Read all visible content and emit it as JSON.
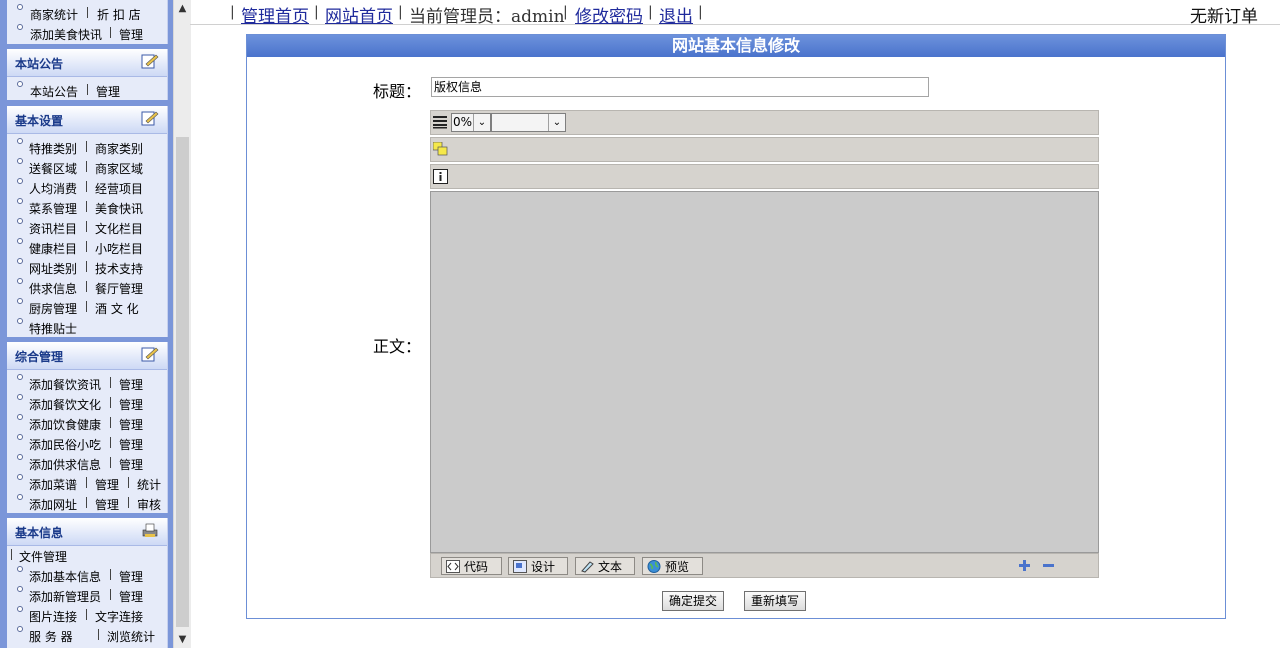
{
  "sidebar": {
    "top_rows": [
      [
        "商家统计",
        "折 扣 店"
      ],
      [
        "添加美食快讯",
        "管理"
      ]
    ],
    "sections": [
      {
        "title": "本站公告",
        "rows": [
          [
            "本站公告",
            "管理"
          ]
        ]
      },
      {
        "title": "基本设置",
        "rows": [
          [
            "特推类别",
            "商家类别"
          ],
          [
            "送餐区域",
            "商家区域"
          ],
          [
            "人均消费",
            "经营项目"
          ],
          [
            "菜系管理",
            "美食快讯"
          ],
          [
            "资讯栏目",
            "文化栏目"
          ],
          [
            "健康栏目",
            "小吃栏目"
          ],
          [
            "网址类别",
            "技术支持"
          ],
          [
            "供求信息",
            "餐厅管理"
          ],
          [
            "厨房管理",
            "酒 文 化"
          ],
          [
            "特推贴士"
          ]
        ]
      },
      {
        "title": "综合管理",
        "rows": [
          [
            "添加餐饮资讯",
            "管理"
          ],
          [
            "添加餐饮文化",
            "管理"
          ],
          [
            "添加饮食健康",
            "管理"
          ],
          [
            "添加民俗小吃",
            "管理"
          ],
          [
            "添加供求信息",
            "管理"
          ],
          [
            "添加菜谱",
            "管理",
            "统计"
          ],
          [
            "添加网址",
            "管理",
            "审核"
          ]
        ]
      },
      {
        "title": "基本信息",
        "rows": [
          [
            "文件管理"
          ],
          [
            "添加基本信息",
            "管理"
          ],
          [
            "添加新管理员",
            "管理"
          ],
          [
            "图片连接",
            "文字连接"
          ],
          [
            "服 务 器",
            "浏览统计"
          ]
        ]
      }
    ]
  },
  "topbar": {
    "admin_home": "管理首页",
    "site_home": "网站首页",
    "current_admin": "当前管理员：admin",
    "change_password": "修改密码",
    "logout": "退出",
    "orders": "无新订单"
  },
  "form": {
    "heading": "网站基本信息修改",
    "title_label": "标题：",
    "title_value": "版权信息",
    "body_label": "正文：",
    "zoom_value": "0%",
    "modes": [
      "代码",
      "设计",
      "文本",
      "预览"
    ],
    "submit": "确定提交",
    "reset": "重新填写"
  }
}
